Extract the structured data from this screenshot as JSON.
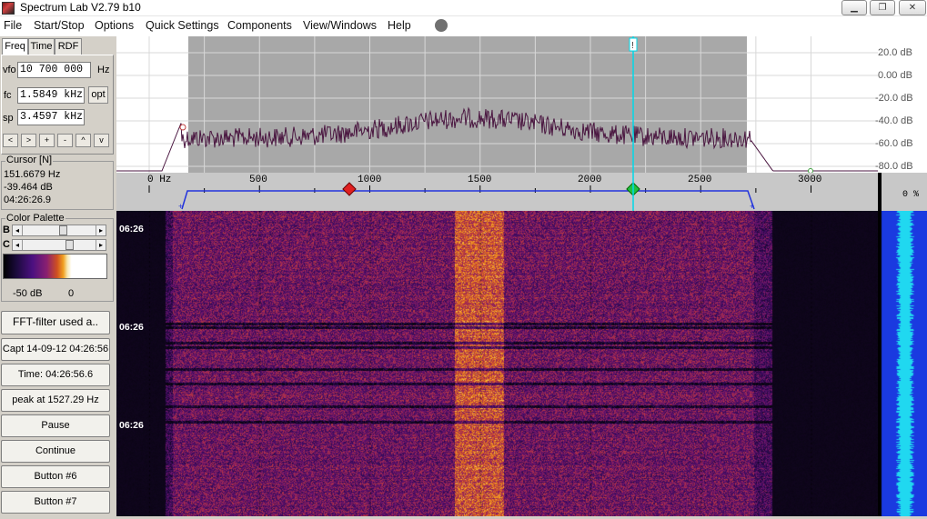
{
  "window": {
    "title": "Spectrum Lab V2.79 b10",
    "controls": [
      "▁",
      "❐",
      "✕"
    ]
  },
  "menu": [
    "File",
    "Start/Stop",
    "Options",
    "Quick Settings",
    "Components",
    "View/Windows",
    "Help"
  ],
  "tabs": [
    "Freq",
    "Time",
    "RDF"
  ],
  "freq": {
    "vfo_label": "vfo",
    "vfo_value": "10 700 000",
    "vfo_unit": "Hz",
    "fc_label": "fc",
    "fc_value": "1.5849 kHz",
    "opt_label": "opt",
    "sp_label": "sp",
    "sp_value": "3.4597 kHz",
    "nav_buttons": [
      "<",
      ">",
      "+",
      "-",
      "^",
      "v"
    ]
  },
  "cursor": {
    "title": "Cursor [N]",
    "freq": "151.6679 Hz",
    "level": "-39.464 dB",
    "time": "04:26:26.9"
  },
  "palette": {
    "title": "Color Palette",
    "b_label": "B",
    "c_label": "C",
    "min_label": "-50 dB",
    "max_label": "0"
  },
  "buttons": [
    "FFT-filter used a..",
    "Capt 14-09-12 04:26:56",
    "Time:  04:26:56.6",
    "peak at 1527.29 Hz",
    "Pause",
    "Continue",
    "Button #6",
    "Button #7"
  ],
  "spectrum": {
    "db_labels": [
      "20.0 dB",
      "0.00 dB",
      "-20.0 dB",
      "-40.0 dB",
      "-60.0 dB",
      "-80.0 dB"
    ],
    "freq_labels": [
      "0 Hz",
      "500",
      "1000",
      "1500",
      "2000",
      "2500",
      "3000"
    ],
    "percent_label": "0 %",
    "marker_label": "!"
  },
  "waterfall": {
    "time_labels": [
      "06:26",
      "06:26",
      "06:26"
    ]
  },
  "colors": {
    "grid_shade": "#a8a8a8",
    "trace": "#4a1640",
    "cursor_line": "#00d8e8",
    "passband": "#2233dd",
    "marker_red": "#e02020",
    "marker_green": "#20c040",
    "level_bar": "#20d8f0",
    "level_bg": "#1a3ae0"
  }
}
